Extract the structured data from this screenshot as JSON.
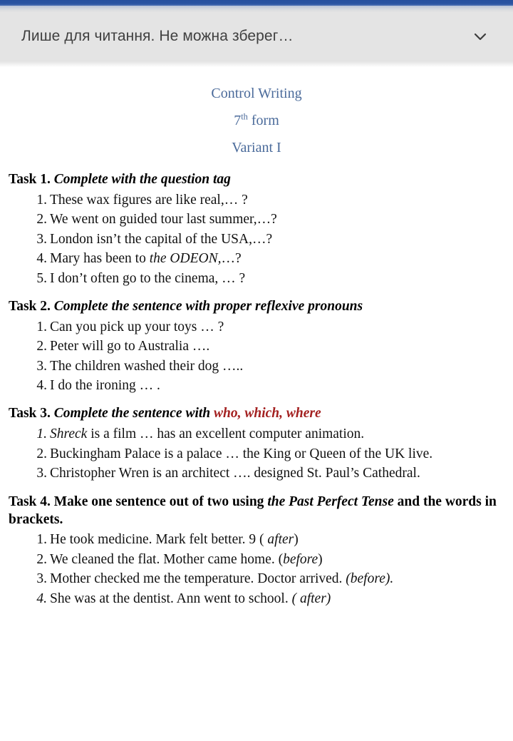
{
  "window": {
    "status_bar_color": "#2c54a0",
    "banner": {
      "title": "Лише для читання. Не можна зберег…",
      "expand_icon": "chevron-down-icon",
      "background_color": "#e4e4e4",
      "text_color": "#3f3f3f"
    }
  },
  "document": {
    "heading_color": "#4a6a9a",
    "accent_red": "#a32020",
    "headings": {
      "line1": "Control Writing",
      "line2_number": "7",
      "line2_sup": "th",
      "line2_rest": " form",
      "line3": "Variant I"
    },
    "tasks": [
      {
        "label": "Task 1.",
        "title": "Complete with the question tag",
        "title_style": "bold-italic",
        "items": [
          {
            "text": "These wax figures are like real,… ?",
            "num_italic": false
          },
          {
            "text": "We went on guided tour last summer,…?",
            "num_italic": false
          },
          {
            "text": "London isn’t the capital of the USA,…?",
            "num_italic": false
          },
          {
            "text": "Mary has been to ",
            "italic": "the ODEON,",
            "text_after": "…?",
            "num_italic": false
          },
          {
            "text": "I don’t often go to the cinema, … ?",
            "num_italic": false
          }
        ]
      },
      {
        "label": "Task 2.",
        "title": "Complete the sentence with proper reflexive pronouns",
        "title_style": "bold-italic",
        "items": [
          {
            "text": "Can you pick up your toys … ?",
            "num_italic": false
          },
          {
            "text": "Peter will go to Australia ….",
            "num_italic": false
          },
          {
            "text": "The children washed their dog …..",
            "num_italic": false
          },
          {
            "text": "I do the ironing … .",
            "num_italic": false
          }
        ]
      },
      {
        "label": "Task 3.",
        "title": "Complete the sentence with ",
        "title_red": "who, which, where",
        "title_style": "bold-italic",
        "items": [
          {
            "text": "",
            "italic": "Shreck",
            "text_after": " is a film … has an excellent computer animation.",
            "num_italic": true
          },
          {
            "text": "Buckingham Palace is a palace … the King or Queen of the UK live.",
            "num_italic": false
          },
          {
            "text": "Christopher Wren is an architect …. designed St. Paul’s Cathedral.",
            "num_italic": false
          }
        ]
      },
      {
        "label": "Task 4. ",
        "title": " Make one sentence out of two using ",
        "title_italic": "the Past Perfect Tense",
        "title_tail": " and the words in brackets.",
        "title_style": "bold",
        "items": [
          {
            "text": "He took medicine. Mark felt better. 9 ( ",
            "italic": "after",
            "text_after": ")",
            "num_italic": false
          },
          {
            "text": "We cleaned the flat. Mother came home. (",
            "italic": "before",
            "text_after": ")",
            "num_italic": false
          },
          {
            "text": "Mother checked me the temperature. Doctor arrived. ",
            "italic": "(before).",
            "text_after": "",
            "num_italic": false
          },
          {
            "text": "She was at the dentist. Ann went to school. ",
            "italic": "( after)",
            "text_after": "",
            "num_italic": true
          }
        ]
      }
    ]
  }
}
